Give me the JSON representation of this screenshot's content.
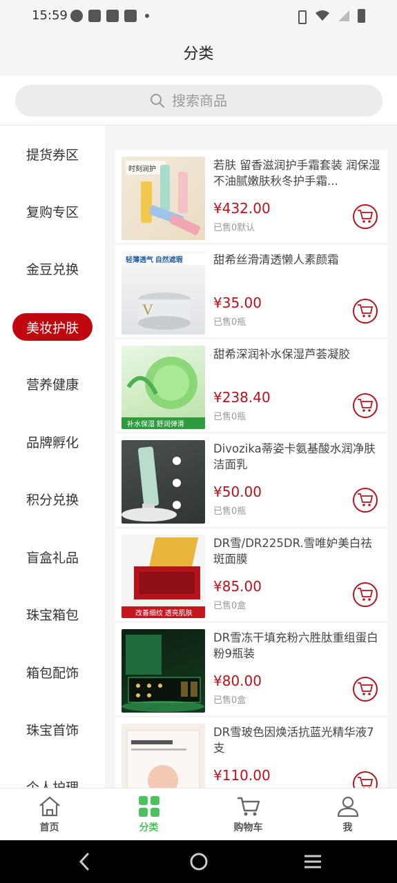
{
  "status_bar": {
    "time": "15:59"
  },
  "header": {
    "title": "分类"
  },
  "search": {
    "placeholder": "搜索商品"
  },
  "sidebar": {
    "items": [
      {
        "label": "提货券区",
        "active": false
      },
      {
        "label": "复购专区",
        "active": false
      },
      {
        "label": "金豆兑换",
        "active": false
      },
      {
        "label": "美妆护肤",
        "active": true
      },
      {
        "label": "营养健康",
        "active": false
      },
      {
        "label": "品牌孵化",
        "active": false
      },
      {
        "label": "积分兑换",
        "active": false
      },
      {
        "label": "盲盒礼品",
        "active": false
      },
      {
        "label": "珠宝箱包",
        "active": false
      },
      {
        "label": "箱包配饰",
        "active": false
      },
      {
        "label": "珠宝首饰",
        "active": false
      },
      {
        "label": "个人护理",
        "active": false
      }
    ]
  },
  "products": [
    {
      "name": "若肤 留香滋润护手霜套装 润保湿不油腻嫩肤秋冬护手霜...",
      "price": "¥432.00",
      "sold": "已售0默认",
      "image_text": "时刻润护 养出漫画手"
    },
    {
      "name": "甜希丝滑清透懒人素颜霜",
      "price": "¥35.00",
      "sold": "已售0瓶",
      "image_text": "轻薄透气 自然遮瑕"
    },
    {
      "name": "甜希深润补水保湿芦荟凝胶",
      "price": "¥238.40",
      "sold": "已售0瓶",
      "image_text": "补水保湿 舒润弹滑"
    },
    {
      "name": "Divozika蒂姿卡氨基酸水润净肤洁面乳",
      "price": "¥50.00",
      "sold": "已售0瓶",
      "image_text": ""
    },
    {
      "name": "DR雪/DR225DR.雪唯妒美白祛斑面膜",
      "price": "¥85.00",
      "sold": "已售0盒",
      "image_text": "改善细纹 透亮肌肤"
    },
    {
      "name": "DR雪冻干填充粉六胜肽重组蛋白粉9瓶装",
      "price": "¥80.00",
      "sold": "已售0盒",
      "image_text": ""
    },
    {
      "name": "DR雪玻色因焕活抗蓝光精华液7支",
      "price": "¥110.00",
      "sold": "",
      "image_text": ""
    }
  ],
  "tab_bar": {
    "tabs": [
      {
        "label": "首页",
        "icon": "home-icon",
        "active": false
      },
      {
        "label": "分类",
        "icon": "category-icon",
        "active": true
      },
      {
        "label": "购物车",
        "icon": "cart-icon",
        "active": false
      },
      {
        "label": "我",
        "icon": "user-icon",
        "active": false
      }
    ]
  },
  "colors": {
    "accent": "#c0060f",
    "price": "#b5121b",
    "tab_active": "#4cc25f"
  }
}
